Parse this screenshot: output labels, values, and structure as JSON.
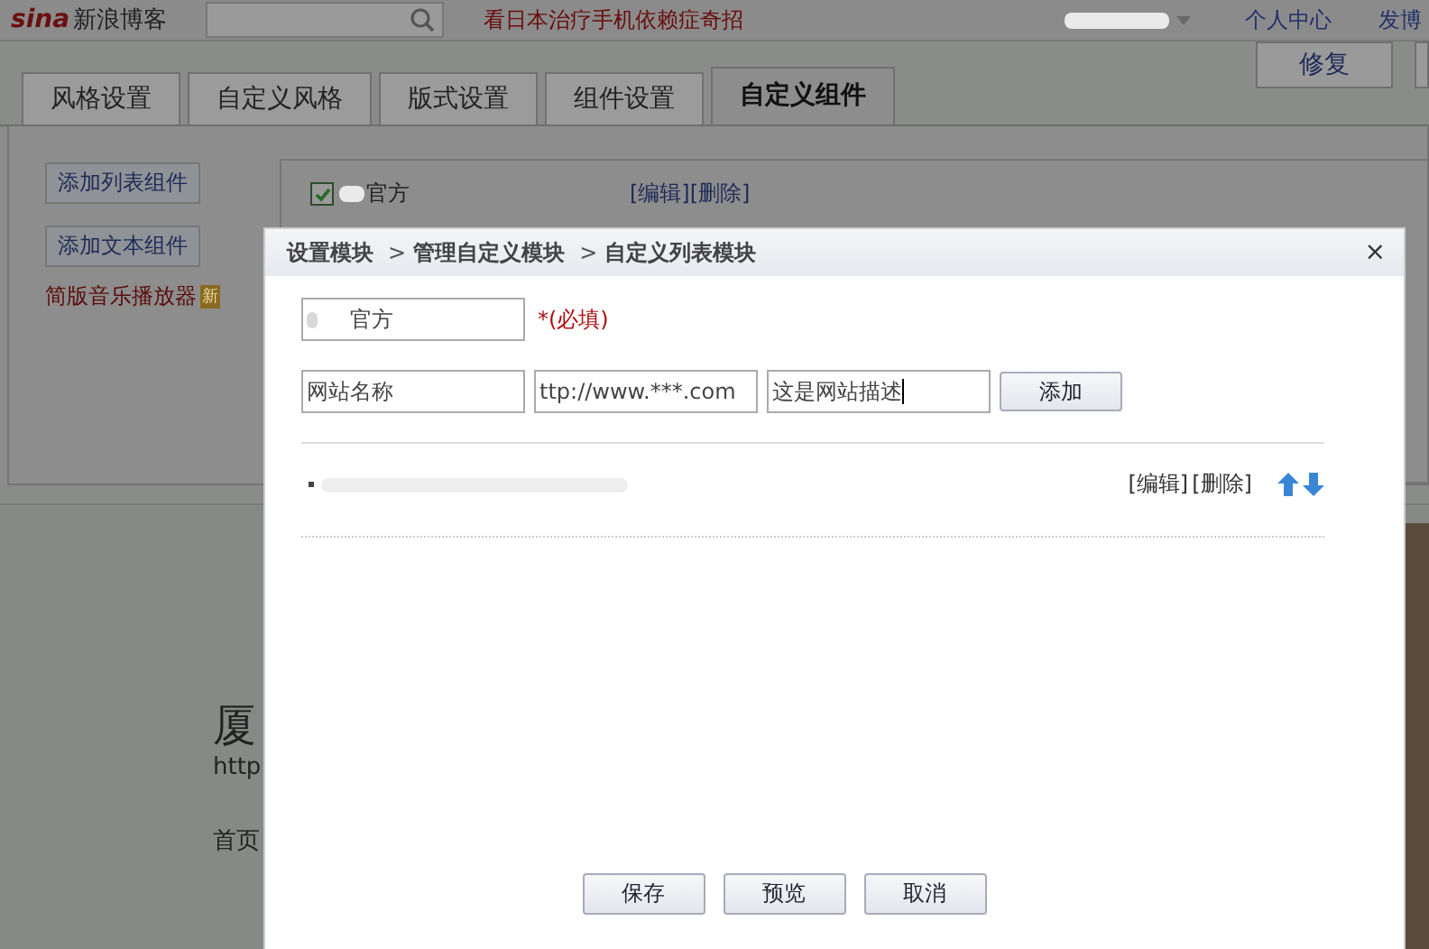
{
  "top_bar": {
    "logo": {
      "mark": "sina",
      "name": "新浪博客"
    },
    "ad_link": "看日本治疗手机依赖症奇招",
    "links": [
      "个人中心",
      "发博"
    ]
  },
  "tabs": [
    {
      "label": "风格设置",
      "selected": false
    },
    {
      "label": "自定义风格",
      "selected": false
    },
    {
      "label": "版式设置",
      "selected": false
    },
    {
      "label": "组件设置",
      "selected": false
    },
    {
      "label": "自定义组件",
      "selected": true
    }
  ],
  "repair_button": "修复",
  "sidebar": {
    "buttons": [
      "添加列表组件",
      "添加文本组件"
    ],
    "music_link": "简版音乐播放器",
    "new_badge": "新"
  },
  "components": [
    {
      "name": "官方",
      "checked": true,
      "actions": [
        "[编辑]",
        "[删除]"
      ]
    }
  ],
  "background_page": {
    "title": "厦",
    "url": "http",
    "nav": "首页"
  },
  "dialog": {
    "breadcrumb": [
      "设置模块",
      "管理自定义模块",
      "自定义列表模块"
    ],
    "separator": ">",
    "close": "×",
    "name_value": "官方",
    "required_note": "*(必填)",
    "link_fields": [
      "网站名称",
      "ttp://www.***.com",
      "这是网站描述"
    ],
    "add_button": "添加",
    "list_items": [
      {
        "actions": [
          "[编辑]",
          "[删除]"
        ]
      }
    ],
    "footer_buttons": [
      "保存",
      "预览",
      "取消"
    ]
  }
}
